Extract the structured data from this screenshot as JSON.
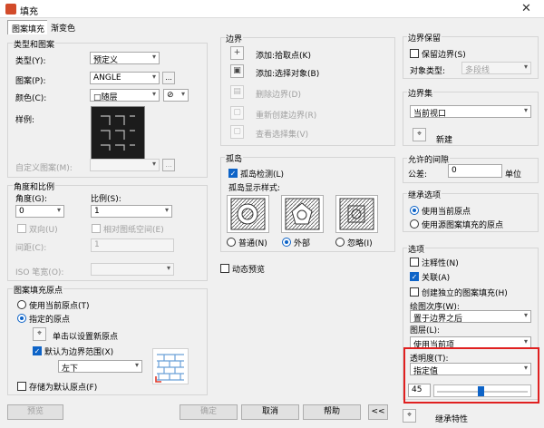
{
  "window": {
    "title": "填充",
    "close_glyph": "✕"
  },
  "tabs": [
    {
      "label": "图案填充"
    },
    {
      "label": "渐变色"
    }
  ],
  "type_pattern": {
    "title": "类型和图案",
    "type_label": "类型(Y):",
    "type_value": "预定义",
    "pattern_label": "图案(P):",
    "pattern_value": "ANGLE",
    "color_label": "颜色(C):",
    "color_value": "□随层",
    "color_extra": "⊘",
    "sample_label": "样例:",
    "custom_label": "自定义图案(M):",
    "ellipsis": "..."
  },
  "angle_scale": {
    "title": "角度和比例",
    "angle_label": "角度(G):",
    "angle_value": "0",
    "scale_label": "比例(S):",
    "scale_value": "1",
    "double_label": "双向(U)",
    "relative_label": "相对图纸空间(E)",
    "spacing_label": "间距(C):",
    "spacing_value": "1",
    "iso_label": "ISO 笔宽(O):"
  },
  "origin": {
    "title": "图案填充原点",
    "use_current_label": "使用当前原点(T)",
    "specified_label": "指定的原点",
    "click_set_label": "单击以设置新原点",
    "default_extent_label": "默认为边界范围(X)",
    "position_value": "左下",
    "store_default_label": "存储为默认原点(F)"
  },
  "boundary": {
    "title": "边界",
    "pick_points_label": "添加:拾取点(K)",
    "select_objects_label": "添加:选择对象(B)",
    "remove_label": "删除边界(D)",
    "recreate_label": "重新创建边界(R)",
    "view_selection_label": "查看选择集(V)"
  },
  "islands": {
    "title": "孤岛",
    "detect_label": "孤岛检测(L)",
    "style_label": "孤岛显示样式:",
    "normal_label": "普通(N)",
    "outer_label": "外部",
    "ignore_label": "忽略(I)"
  },
  "preview_dynamic_label": "动态预览",
  "retention": {
    "title": "边界保留",
    "retain_label": "保留边界(S)",
    "object_type_label": "对象类型:",
    "object_type_value": "多段线"
  },
  "boundary_set": {
    "title": "边界集",
    "value": "当前视口",
    "new_label": "新建"
  },
  "gap": {
    "title": "允许的间隙",
    "tolerance_label": "公差:",
    "tolerance_value": "0",
    "unit_label": "单位"
  },
  "inherit_options": {
    "title": "继承选项",
    "use_current_label": "使用当前原点",
    "use_source_label": "使用源图案填充的原点"
  },
  "options": {
    "title": "选项",
    "annotative_label": "注释性(N)",
    "associative_label": "关联(A)",
    "separate_label": "创建独立的图案填充(H)",
    "draw_order_label": "绘图次序(W):",
    "draw_order_value": "置于边界之后",
    "layer_label": "图层(L):",
    "layer_value": "使用当前项",
    "transparency_label": "透明度(T):",
    "transparency_mode": "指定值",
    "transparency_value": "45",
    "transparency_level": 0.45
  },
  "inherit_button_label": "继承特性",
  "footer": {
    "preview": "预览",
    "ok": "确定",
    "cancel": "取消",
    "help": "帮助",
    "collapse": "<<"
  },
  "colors": {
    "highlight": "#e02020",
    "accent": "#0d63c7"
  }
}
